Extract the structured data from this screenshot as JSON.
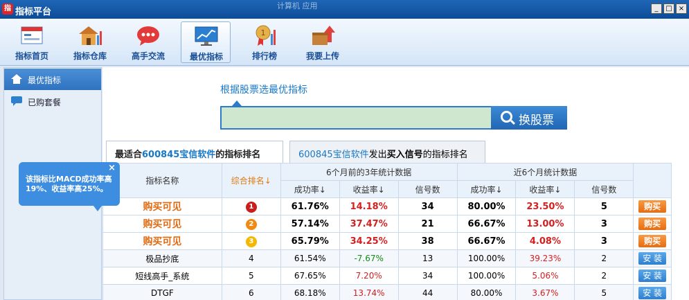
{
  "window": {
    "title": "指标平台",
    "center_text": "计算机 应用",
    "min": "_",
    "max": "□",
    "close": "×"
  },
  "toolbar": {
    "items": [
      {
        "label": "指标首页",
        "icon": "home-page-icon"
      },
      {
        "label": "指标仓库",
        "icon": "warehouse-icon"
      },
      {
        "label": "高手交流",
        "icon": "chat-icon"
      },
      {
        "label": "最优指标",
        "icon": "chart-screen-icon",
        "active": true
      },
      {
        "label": "排行榜",
        "icon": "medal-icon"
      },
      {
        "label": "我要上传",
        "icon": "upload-icon"
      }
    ]
  },
  "sidebar": {
    "items": [
      {
        "label": "最优指标",
        "active": true,
        "icon": "home-icon"
      },
      {
        "label": "已购套餐",
        "active": false,
        "icon": "message-icon"
      }
    ]
  },
  "search": {
    "label": "根据股票选最优指标",
    "value": "",
    "button": "换股票"
  },
  "tabs": {
    "tab1": {
      "prefix": "最适合",
      "stock": "600845宝信软件",
      "suffix": "的指标排名"
    },
    "tab2": {
      "stock": "600845宝信软件",
      "mid": "发出",
      "bold": "买入信号",
      "suffix": "的指标排名"
    }
  },
  "table": {
    "headers": {
      "name": "指标名称",
      "rank": "综合排名↓",
      "group1": "6个月前的3年统计数据",
      "group2": "近6个月统计数据",
      "success": "成功率↓",
      "profit": "收益率↓",
      "signals": "信号数"
    },
    "rows": [
      {
        "name": "购买可见",
        "rank": "1",
        "s1": "61.76%",
        "p1": "14.18%",
        "n1": "34",
        "s2": "80.00%",
        "p2": "23.50%",
        "n2": "5",
        "action": "购买",
        "top": true
      },
      {
        "name": "购买可见",
        "rank": "2",
        "s1": "57.14%",
        "p1": "37.47%",
        "n1": "21",
        "s2": "66.67%",
        "p2": "13.00%",
        "n2": "3",
        "action": "购买",
        "top": true
      },
      {
        "name": "购买可见",
        "rank": "3",
        "s1": "65.79%",
        "p1": "34.25%",
        "n1": "38",
        "s2": "66.67%",
        "p2": "4.08%",
        "n2": "3",
        "action": "购买",
        "top": true
      },
      {
        "name": "极品抄底",
        "rank": "4",
        "s1": "61.54%",
        "p1": "-7.67%",
        "n1": "13",
        "s2": "100.00%",
        "p2": "39.23%",
        "n2": "2",
        "action": "安 装",
        "top": false
      },
      {
        "name": "短线高手_系统",
        "rank": "5",
        "s1": "67.65%",
        "p1": "7.20%",
        "n1": "34",
        "s2": "100.00%",
        "p2": "5.06%",
        "n2": "2",
        "action": "安 装",
        "top": false
      },
      {
        "name": "DTGF",
        "rank": "6",
        "s1": "68.18%",
        "p1": "13.74%",
        "n1": "44",
        "s2": "80.00%",
        "p2": "3.67%",
        "n2": "5",
        "action": "安 装",
        "top": false
      }
    ],
    "rank_colors": [
      "#c81e1e",
      "#f08a12",
      "#f5b800"
    ]
  },
  "tooltip": {
    "text": "该指标比MACD成功率高19%、收益率高25%。",
    "close": "×"
  }
}
